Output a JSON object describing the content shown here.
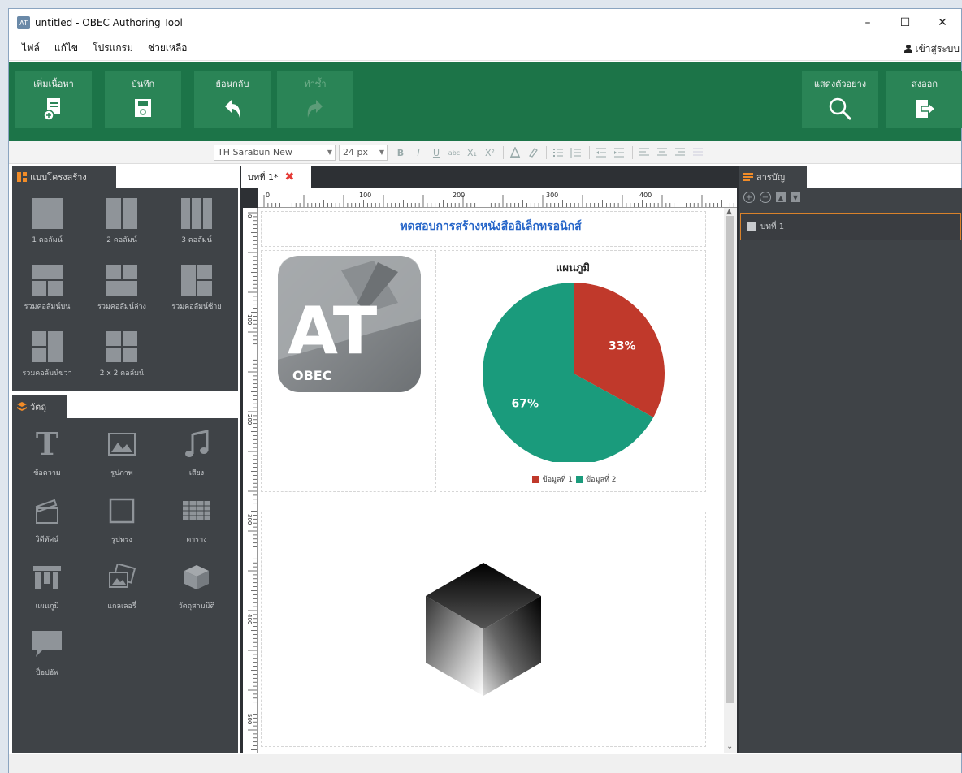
{
  "window": {
    "app_icon_text": "AT",
    "title": "untitled - OBEC Authoring Tool",
    "minimize": "–",
    "maximize": "☐",
    "close": "✕"
  },
  "menu": {
    "items": [
      "ไฟล์",
      "แก้ไข",
      "โปรแกรม",
      "ช่วยเหลือ"
    ],
    "login_label": "เข้าสู่ระบบ"
  },
  "toolbar": {
    "add_content": "เพิ่มเนื้อหา",
    "save": "บันทึก",
    "undo": "ย้อนกลับ",
    "redo": "ทำซ้ำ",
    "preview": "แสดงตัวอย่าง",
    "export": "ส่งออก"
  },
  "format": {
    "font": "TH Sarabun New",
    "size": "24 px",
    "buttons": [
      "B",
      "I",
      "U",
      "abc",
      "X₁",
      "X²"
    ]
  },
  "layout_panel": {
    "title": "แบบโครงสร้าง",
    "items": [
      {
        "label": "1 คอลัมน์"
      },
      {
        "label": "2 คอลัมน์"
      },
      {
        "label": "3 คอลัมน์"
      },
      {
        "label": "รวมคอลัมน์บน"
      },
      {
        "label": "รวมคอลัมน์ล่าง"
      },
      {
        "label": "รวมคอลัมน์ซ้าย"
      },
      {
        "label": "รวมคอลัมน์ขวา"
      },
      {
        "label": "2 x 2 คอลัมน์"
      }
    ]
  },
  "objects_panel": {
    "title": "วัตถุ",
    "items": [
      {
        "label": "ข้อความ",
        "icon": "text-icon"
      },
      {
        "label": "รูปภาพ",
        "icon": "image-icon"
      },
      {
        "label": "เสียง",
        "icon": "music-icon"
      },
      {
        "label": "วิดีทัศน์",
        "icon": "video-icon"
      },
      {
        "label": "รูปทรง",
        "icon": "shape-icon"
      },
      {
        "label": "ตาราง",
        "icon": "table-icon"
      },
      {
        "label": "แผนภูมิ",
        "icon": "chart-icon"
      },
      {
        "label": "แกลเลอรี่",
        "icon": "gallery-icon"
      },
      {
        "label": "วัตถุสามมิติ",
        "icon": "cube-icon"
      },
      {
        "label": "ป็อปอัพ",
        "icon": "popup-icon"
      }
    ]
  },
  "document": {
    "tab_label": "บทที่ 1*",
    "ruler_h": [
      "0",
      "100",
      "200",
      "300",
      "400"
    ],
    "ruler_v": [
      "0",
      "100",
      "200",
      "300",
      "400",
      "500"
    ],
    "page_title": "ทดสอบการสร้างหนังสืออิเล็กทรอนิกส์",
    "logo_text_main": "AT",
    "logo_text_sub": "OBEC"
  },
  "chart_data": {
    "type": "pie",
    "title": "แผนภูมิ",
    "categories": [
      "ข้อมูลที่ 1",
      "ข้อมูลที่ 2"
    ],
    "values": [
      33,
      67
    ],
    "labels": [
      "33%",
      "67%"
    ],
    "colors": [
      "#c0392b",
      "#1a9b7c"
    ],
    "legend": "bottom"
  },
  "toc_panel": {
    "title": "สารบัญ",
    "pages": [
      "บทที่ 1"
    ]
  },
  "colors": {
    "toolbar_green": "#1c7448",
    "panel_dark": "#3f4347",
    "accent_orange": "#f28c28",
    "title_blue": "#2464c8"
  }
}
